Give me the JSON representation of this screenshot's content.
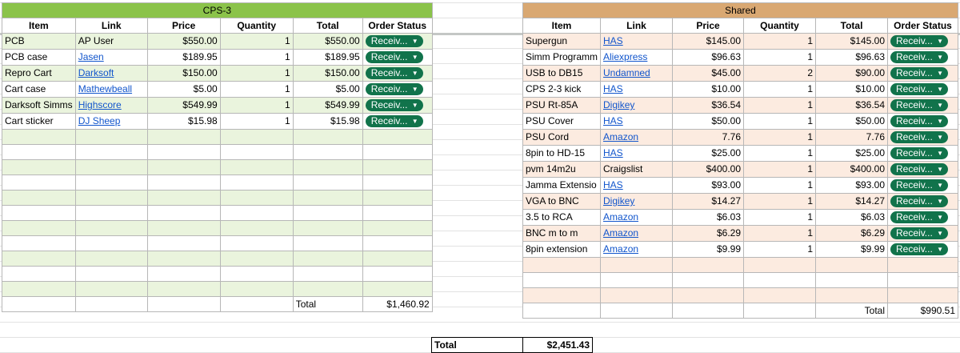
{
  "cps3": {
    "title": "CPS-3",
    "headers": [
      "Item",
      "Link",
      "Price",
      "Quantity",
      "Total",
      "Order Status"
    ],
    "rows": [
      {
        "item": "PCB",
        "link": "AP User",
        "link_is_url": false,
        "price": "$550.00",
        "qty": "1",
        "total": "$550.00",
        "status": "Receiv..."
      },
      {
        "item": "PCB case",
        "link": "Jasen",
        "link_is_url": true,
        "price": "$189.95",
        "qty": "1",
        "total": "$189.95",
        "status": "Receiv..."
      },
      {
        "item": "Repro Cart",
        "link": "Darksoft",
        "link_is_url": true,
        "price": "$150.00",
        "qty": "1",
        "total": "$150.00",
        "status": "Receiv..."
      },
      {
        "item": "Cart case",
        "link": "Mathewbeall",
        "link_is_url": true,
        "price": "$5.00",
        "qty": "1",
        "total": "$5.00",
        "status": "Receiv..."
      },
      {
        "item": "Darksoft Simms",
        "link": "Highscore",
        "link_is_url": true,
        "price": "$549.99",
        "qty": "1",
        "total": "$549.99",
        "status": "Receiv..."
      },
      {
        "item": "Cart sticker",
        "link": "DJ Sheep",
        "link_is_url": true,
        "price": "$15.98",
        "qty": "1",
        "total": "$15.98",
        "status": "Receiv..."
      }
    ],
    "empty_rows": 11,
    "total_label": "Total",
    "total_value": "$1,460.92"
  },
  "shared": {
    "title": "Shared",
    "headers": [
      "Item",
      "Link",
      "Price",
      "Quantity",
      "Total",
      "Order Status"
    ],
    "rows": [
      {
        "item": "Supergun",
        "link": "HAS",
        "link_is_url": true,
        "price": "$145.00",
        "qty": "1",
        "total": "$145.00",
        "status": "Receiv..."
      },
      {
        "item": "Simm Programm",
        "link": "Aliexpress",
        "link_is_url": true,
        "price": "$96.63",
        "qty": "1",
        "total": "$96.63",
        "status": "Receiv..."
      },
      {
        "item": "USB to DB15",
        "link": "Undamned",
        "link_is_url": true,
        "price": "$45.00",
        "qty": "2",
        "total": "$90.00",
        "status": "Receiv..."
      },
      {
        "item": "CPS 2-3 kick",
        "link": "HAS",
        "link_is_url": true,
        "price": "$10.00",
        "qty": "1",
        "total": "$10.00",
        "status": "Receiv..."
      },
      {
        "item": "PSU Rt-85A",
        "link": "Digikey",
        "link_is_url": true,
        "price": "$36.54",
        "qty": "1",
        "total": "$36.54",
        "status": "Receiv..."
      },
      {
        "item": "PSU Cover",
        "link": "HAS",
        "link_is_url": true,
        "price": "$50.00",
        "qty": "1",
        "total": "$50.00",
        "status": "Receiv..."
      },
      {
        "item": "PSU Cord",
        "link": "Amazon",
        "link_is_url": true,
        "price": "7.76",
        "qty": "1",
        "total": "7.76",
        "status": "Receiv..."
      },
      {
        "item": "8pin to HD-15",
        "link": "HAS",
        "link_is_url": true,
        "price": "$25.00",
        "qty": "1",
        "total": "$25.00",
        "status": "Receiv..."
      },
      {
        "item": "pvm 14m2u",
        "link": "Craigslist",
        "link_is_url": false,
        "price": "$400.00",
        "qty": "1",
        "total": "$400.00",
        "status": "Receiv..."
      },
      {
        "item": "Jamma Extensio",
        "link": "HAS",
        "link_is_url": true,
        "price": "$93.00",
        "qty": "1",
        "total": "$93.00",
        "status": "Receiv..."
      },
      {
        "item": "VGA to BNC",
        "link": "Digikey",
        "link_is_url": true,
        "price": "$14.27",
        "qty": "1",
        "total": "$14.27",
        "status": "Receiv..."
      },
      {
        "item": "3.5 to RCA",
        "link": "Amazon",
        "link_is_url": true,
        "price": "$6.03",
        "qty": "1",
        "total": "$6.03",
        "status": "Receiv..."
      },
      {
        "item": "BNC m to m",
        "link": "Amazon",
        "link_is_url": true,
        "price": "$6.29",
        "qty": "1",
        "total": "$6.29",
        "status": "Receiv..."
      },
      {
        "item": "8pin extension",
        "link": "Amazon",
        "link_is_url": true,
        "price": "$9.99",
        "qty": "1",
        "total": "$9.99",
        "status": "Receiv..."
      }
    ],
    "empty_rows": 3,
    "total_label": "Total",
    "total_value": "$990.51"
  },
  "grand_total": {
    "label": "Total",
    "value": "$2,451.43"
  },
  "icons": {
    "dropdown_caret": "caret-down-icon"
  },
  "colors": {
    "cps_header": "#8bc34a",
    "cps_band": "#eaf4dd",
    "shared_header": "#d9a872",
    "shared_band": "#fcebe0",
    "chip": "#11734b",
    "link": "#1155cc"
  }
}
